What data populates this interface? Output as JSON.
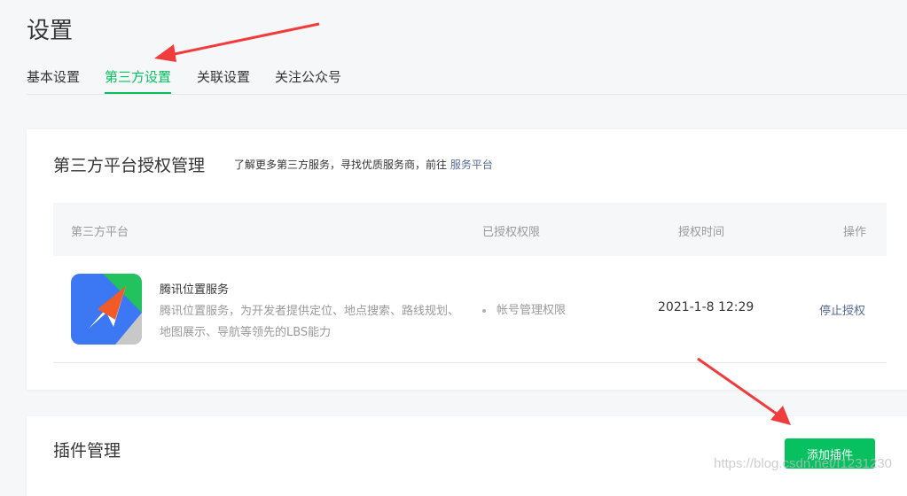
{
  "page": {
    "title": "设置"
  },
  "tabs": [
    {
      "label": "基本设置",
      "active": false
    },
    {
      "label": "第三方设置",
      "active": true
    },
    {
      "label": "关联设置",
      "active": false
    },
    {
      "label": "关注公众号",
      "active": false
    }
  ],
  "third_party": {
    "title": "第三方平台授权管理",
    "desc_text": "了解更多第三方服务，寻找优质服务商，前往",
    "desc_link": "服务平台",
    "columns": {
      "platform": "第三方平台",
      "permissions": "已授权权限",
      "time": "授权时间",
      "action": "操作"
    },
    "rows": [
      {
        "name": "腾讯位置服务",
        "description": "腾讯位置服务，为开发者提供定位、地点搜索、路线规划、地图展示、导航等领先的LBS能力",
        "permission": "帐号管理权限",
        "time": "2021-1-8 12:29",
        "action": "停止授权"
      }
    ]
  },
  "plugins": {
    "title": "插件管理",
    "add_button": "添加插件"
  },
  "watermark": "https://blog.csdn.net/I1231230",
  "colors": {
    "accent": "#07c160",
    "link": "#576b95",
    "annotation_arrow": "#f03c3c"
  },
  "icons": {
    "app_logo": "tencent-location-service-icon"
  }
}
